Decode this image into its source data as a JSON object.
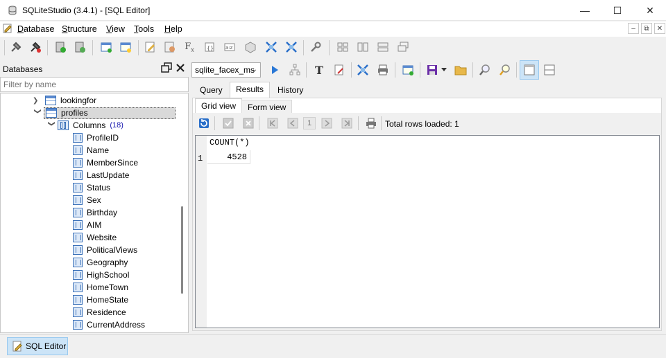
{
  "window": {
    "title": "SQLiteStudio (3.4.1) - [SQL Editor]",
    "minimize": "—",
    "maximize": "☐",
    "close": "✕"
  },
  "menu": [
    {
      "label": "Database"
    },
    {
      "label": "Structure"
    },
    {
      "label": "View"
    },
    {
      "label": "Tools"
    },
    {
      "label": "Help"
    }
  ],
  "mdi_controls": {
    "minimize": "–",
    "restore": "⧉",
    "close": "✕"
  },
  "databases_panel": {
    "title": "Databases",
    "filter_placeholder": "Filter by name",
    "tree": {
      "table_lookingfor": "lookingfor",
      "table_profiles": "profiles",
      "columns_label": "Columns",
      "columns_count": "(18)",
      "columns": [
        "ProfileID",
        "Name",
        "MemberSince",
        "LastUpdate",
        "Status",
        "Sex",
        "Birthday",
        "AIM",
        "Website",
        "PoliticalViews",
        "Geography",
        "HighSchool",
        "HomeTown",
        "HomeState",
        "Residence",
        "CurrentAddress"
      ]
    }
  },
  "editor": {
    "database_combo": "sqlite_facex_ms",
    "tabs": [
      "Query",
      "Results",
      "History"
    ],
    "active_tab": "Results",
    "subtabs": [
      "Grid view",
      "Form view"
    ],
    "active_subtab": "Grid view",
    "page_number": "1",
    "rows_loaded": "Total rows loaded: 1",
    "grid": {
      "columns": [
        "COUNT(*)"
      ],
      "rows": [
        {
          "num": "1",
          "values": [
            "4528"
          ]
        }
      ]
    }
  },
  "taskbar": {
    "item": "SQL Editor"
  },
  "colors": {
    "accent": "#cce4f7",
    "tree_selected": "#d9d9d9"
  }
}
